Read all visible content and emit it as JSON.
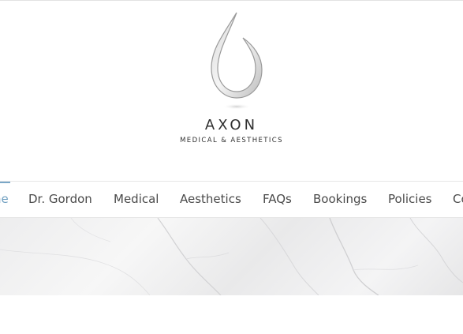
{
  "brand": {
    "name": "AXON",
    "tagline": "MEDICAL & AESTHETICS",
    "logo_icon": "droplet-icon"
  },
  "nav": {
    "items": [
      {
        "label": "ne",
        "active": true
      },
      {
        "label": "Dr. Gordon"
      },
      {
        "label": "Medical"
      },
      {
        "label": "Aesthetics"
      },
      {
        "label": "FAQs"
      },
      {
        "label": "Bookings"
      },
      {
        "label": "Policies"
      },
      {
        "label": "Co"
      }
    ],
    "active_color": "#6f9fc0",
    "text_color": "#4a4a4a"
  },
  "hero": {
    "style": "white-marble"
  }
}
